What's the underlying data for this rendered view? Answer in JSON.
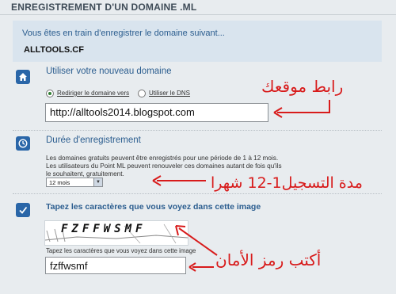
{
  "header": {
    "title": "ENREGISTREMENT D'UN DOMAINE .ML"
  },
  "intro": {
    "text": "Vous êtes en train d'enregistrer le domaine suivant...",
    "domain": "ALLTOOLS.CF"
  },
  "section_new_domain": {
    "icon": "home-icon",
    "title": "Utiliser votre nouveau domaine",
    "options": [
      {
        "label": "Rediriger le domaine vers",
        "selected": true
      },
      {
        "label": "Utiliser le DNS",
        "selected": false
      }
    ],
    "redirect_value": "http://alltools2014.blogspot.com"
  },
  "section_duration": {
    "icon": "clock-icon",
    "title": "Durée d'enregistrement",
    "description": "Les domaines gratuits peuvent être enregistrés pour une période de 1 à 12 mois. Les utilisateurs du Point ML peuvent renouveler ces domaines autant de fois qu'ils le souhaitent, gratuitement.",
    "selected_period": "12 mois"
  },
  "section_captcha": {
    "icon": "check-icon",
    "title": "Tapez les caractères que vous voyez dans cette image",
    "captcha_image_text": "FZFFWSMF",
    "input_label": "Tapez les caractères que vous voyez dans cette image",
    "input_value": "fzffwsmf"
  },
  "annotations": {
    "site_link": "رابط موقعك",
    "period": "مدة التسجيل1-12 شهرا",
    "security_code": "أكتب رمز الأمان"
  },
  "colors": {
    "accent": "#2b5d8f",
    "annotation": "#d81b1b",
    "icon_bg": "#2a66a8"
  }
}
